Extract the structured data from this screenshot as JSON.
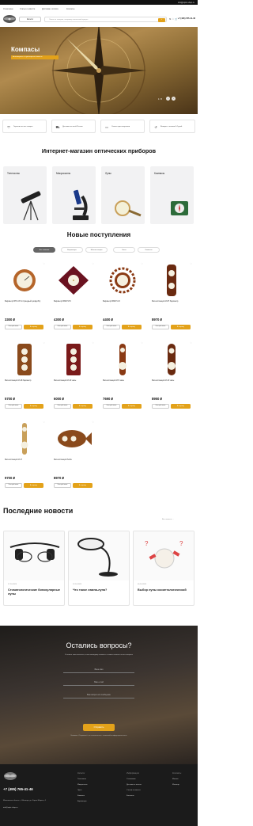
{
  "topbar": {
    "email": "info@optic-shop.ru"
  },
  "nav": {
    "items": [
      "О магазине",
      "Статьи и новости",
      "Доставка и оплата",
      "Контакты"
    ]
  },
  "header": {
    "catalog_label": "Каталог",
    "search_placeholder": "Поиск по товарам, например оптический прицел",
    "search_button": "Найти",
    "phone": "+7 (495) 765-41-46"
  },
  "hero": {
    "title": "Компасы",
    "subtitle": "Антикварные и сувенирные компасы",
    "counter": "1 / 5"
  },
  "features": [
    {
      "icon": "shield-icon",
      "text": "Гарантия на все товары"
    },
    {
      "icon": "truck-icon",
      "text": "Доставка по всей России"
    },
    {
      "icon": "card-icon",
      "text": "Оплата при получении"
    },
    {
      "icon": "return-icon",
      "text": "Возврат в течение 14 дней"
    }
  ],
  "shop_title": "Интернет-магазин оптических приборов",
  "categories": [
    "Телескопы",
    "Микроскопы",
    "Лупы",
    "Компасы"
  ],
  "new_title": "Новые поступления",
  "tabs": [
    "Все новинки",
    "Барометры",
    "Метеостанции",
    "Часы",
    "Компасы"
  ],
  "products": [
    {
      "name": "Барометр БТК-СН-14 (медный цифербл)",
      "price": "3300 ₽"
    },
    {
      "name": "Барометр БМ07-РЗ",
      "price": "4300 ₽"
    },
    {
      "name": "Барометр БМ07-СЗ",
      "price": "4400 ₽"
    },
    {
      "name": "Метеостанция М-ЗГ барометр",
      "price": "8970 ₽"
    },
    {
      "name": "Метеостанция М-18 барометр",
      "price": "5700 ₽"
    },
    {
      "name": "Метеостанция М-16 часы",
      "price": "6000 ₽"
    },
    {
      "name": "Метеостанция М-5 часы",
      "price": "7690 ₽"
    },
    {
      "name": "Метеостанция М-13 часы",
      "price": "8950 ₽"
    },
    {
      "name": "Метеостанция М-17",
      "price": "9700 ₽"
    },
    {
      "name": "Метеостанция Рыба",
      "price": "8970 ₽"
    }
  ],
  "product_buttons": {
    "quick": "Быстрый заказ",
    "cart": "В корзину"
  },
  "news": {
    "title": "Последние новости",
    "all_link": "Все новости →",
    "items": [
      {
        "date": "17.10.2023",
        "title": "Стоматологические бинокулярные лупы"
      },
      {
        "date": "12.10.2023",
        "title": "Что такое лампа-лупа?"
      },
      {
        "date": "05.10.2023",
        "title": "Выбор лупы косметологической"
      }
    ]
  },
  "contact": {
    "title": "Остались вопросы?",
    "subtitle": "Оставьте свои контакты, и наш менеджер свяжется с вами и ответит на все вопросы",
    "fields": [
      "Ваше имя",
      "Ваш e-mail",
      "Ваш вопрос или сообщение"
    ],
    "send": "Отправить",
    "consent": "Нажимая «Отправить», вы соглашаетесь с политикой конфиденциальности"
  },
  "footer": {
    "phone": "+7 (495) 765-41-46",
    "address": "Московская область, г. Мытищи, ул. Карла Маркса, 4",
    "email": "info@optic-shop.ru",
    "col1_title": "Каталог",
    "col1": [
      "Телескопы",
      "Микроскопы",
      "Лупы",
      "Компасы",
      "Барометры"
    ],
    "col2_title": "Информация",
    "col2": [
      "О магазине",
      "Доставка и оплата",
      "Статьи и новости",
      "Контакты"
    ],
    "col3_title": "Контакты",
    "col3": [
      "Москва",
      "Мытищи"
    ]
  }
}
